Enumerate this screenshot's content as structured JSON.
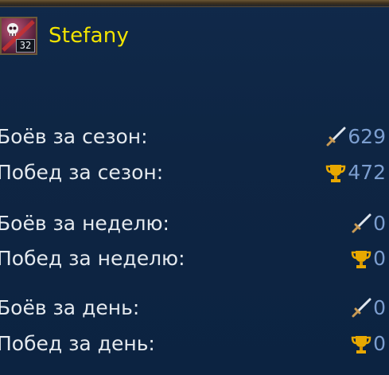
{
  "header": {
    "player_name": "Stefany",
    "level": "32",
    "avatar_icon": "skull-avatar-icon"
  },
  "stats": [
    {
      "label": "Боёв за сезон:",
      "icon": "sword-icon",
      "value": "629"
    },
    {
      "label": "Побед за сезон:",
      "icon": "trophy-icon",
      "value": "472"
    },
    {
      "label": "Боёв за неделю:",
      "icon": "sword-icon",
      "value": "0"
    },
    {
      "label": "Побед за неделю:",
      "icon": "trophy-icon",
      "value": "0"
    },
    {
      "label": "Боёв за день:",
      "icon": "sword-icon",
      "value": "0"
    },
    {
      "label": "Побед за день:",
      "icon": "trophy-icon",
      "value": "0"
    }
  ],
  "colors": {
    "background": "#0d2644",
    "player_name": "#f3e400",
    "label_text": "#e4e9ee",
    "value_text": "#7c9ecf",
    "trophy": "#e8a800"
  }
}
